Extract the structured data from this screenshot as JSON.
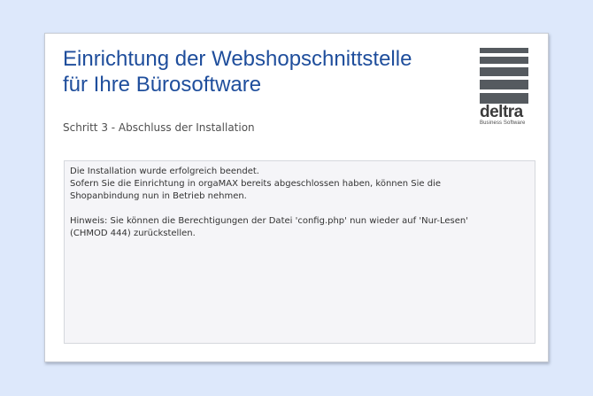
{
  "header": {
    "title_line1": "Einrichtung der Webshopschnittstelle",
    "title_line2": "für Ihre Bürosoftware",
    "step": "Schritt 3 - Abschluss der Installation"
  },
  "logo": {
    "wordmark": "deltra",
    "tagline": "Business Software"
  },
  "message": {
    "line1": "Die Installation wurde erfolgreich beendet.",
    "line2": "Sofern Sie die Einrichtung in orgaMAX bereits abgeschlossen haben, können Sie die",
    "line3": "Shopanbindung nun in Betrieb nehmen.",
    "line4": "Hinweis: Sie können die Berechtigungen der Datei 'config.php' nun wieder auf 'Nur-Lesen'",
    "line5": "(CHMOD 444) zurückstellen."
  },
  "colors": {
    "background": "#dde8fb",
    "title": "#1f4e9c",
    "logo": "#555a5f"
  }
}
